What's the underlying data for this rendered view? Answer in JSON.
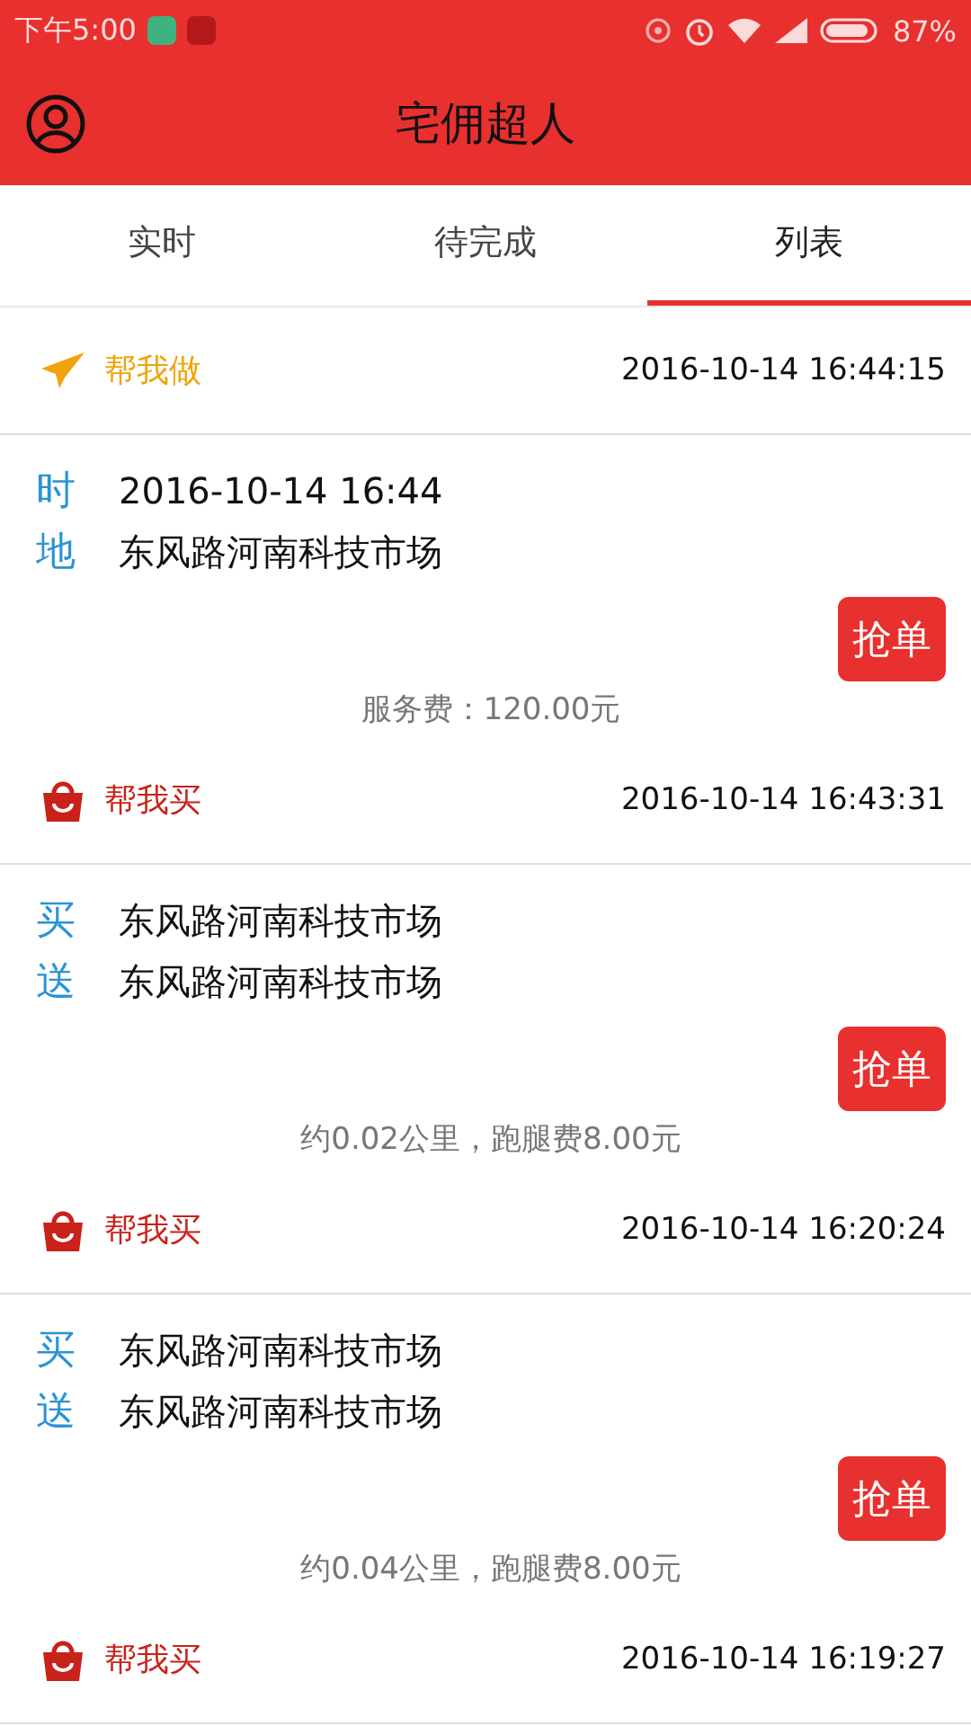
{
  "status_bar": {
    "time": "下午5:00",
    "battery": "87%"
  },
  "app_bar": {
    "title": "宅佣超人"
  },
  "tabs": [
    {
      "label": "实时",
      "selected": false
    },
    {
      "label": "待完成",
      "selected": false
    },
    {
      "label": "列表",
      "selected": true
    }
  ],
  "orders": [
    {
      "kind": "do",
      "type_label": "帮我做",
      "timestamp": "2016-10-14 16:44:15",
      "rows": [
        {
          "label": "时",
          "value": "2016-10-14 16:44"
        },
        {
          "label": "地",
          "value": "东风路河南科技市场"
        }
      ],
      "action": "抢单",
      "fee": "服务费：120.00元"
    },
    {
      "kind": "buy",
      "type_label": "帮我买",
      "timestamp": "2016-10-14 16:43:31",
      "rows": [
        {
          "label": "买",
          "value": "东风路河南科技市场"
        },
        {
          "label": "送",
          "value": "东风路河南科技市场"
        }
      ],
      "action": "抢单",
      "fee": "约0.02公里，跑腿费8.00元"
    },
    {
      "kind": "buy",
      "type_label": "帮我买",
      "timestamp": "2016-10-14 16:20:24",
      "rows": [
        {
          "label": "买",
          "value": "东风路河南科技市场"
        },
        {
          "label": "送",
          "value": "东风路河南科技市场"
        }
      ],
      "action": "抢单",
      "fee": "约0.04公里，跑腿费8.00元"
    },
    {
      "kind": "buy",
      "type_label": "帮我买",
      "timestamp": "2016-10-14 16:19:27"
    }
  ]
}
